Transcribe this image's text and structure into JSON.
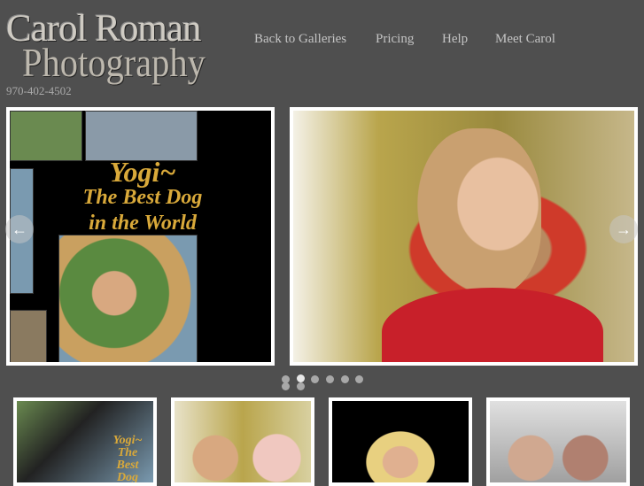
{
  "brand": {
    "line1": "Carol Roman",
    "line2": "Photography",
    "phone": "970-402-4502"
  },
  "nav": [
    "Back to Galleries",
    "Pricing",
    "Help",
    "Meet Carol"
  ],
  "slider": {
    "slide1_text": {
      "line1": "Yogi~",
      "line2": "The Best Dog",
      "line3": "in the World"
    },
    "prev_icon": "arrow-left-icon",
    "next_icon": "arrow-right-icon",
    "prev_glyph": "←",
    "next_glyph": "→",
    "dot_count": 8,
    "active_dot": 2
  },
  "thumbnails": [
    {
      "text": "Yogi~ The Best Dog"
    },
    {
      "text": ""
    },
    {
      "text": ""
    },
    {
      "text": ""
    }
  ]
}
